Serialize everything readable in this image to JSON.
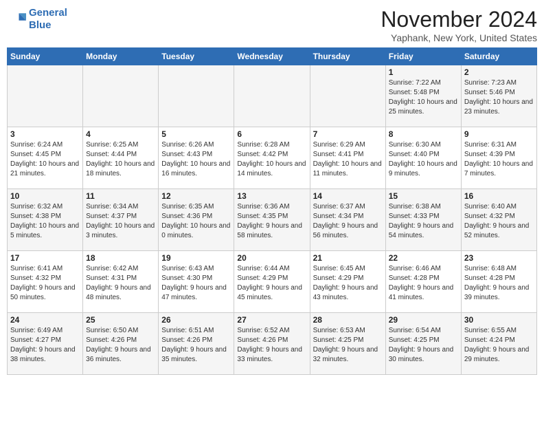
{
  "header": {
    "logo_line1": "General",
    "logo_line2": "Blue",
    "month": "November 2024",
    "location": "Yaphank, New York, United States"
  },
  "days_of_week": [
    "Sunday",
    "Monday",
    "Tuesday",
    "Wednesday",
    "Thursday",
    "Friday",
    "Saturday"
  ],
  "weeks": [
    [
      {
        "day": "",
        "text": ""
      },
      {
        "day": "",
        "text": ""
      },
      {
        "day": "",
        "text": ""
      },
      {
        "day": "",
        "text": ""
      },
      {
        "day": "",
        "text": ""
      },
      {
        "day": "1",
        "text": "Sunrise: 7:22 AM\nSunset: 5:48 PM\nDaylight: 10 hours and 25 minutes."
      },
      {
        "day": "2",
        "text": "Sunrise: 7:23 AM\nSunset: 5:46 PM\nDaylight: 10 hours and 23 minutes."
      }
    ],
    [
      {
        "day": "3",
        "text": "Sunrise: 6:24 AM\nSunset: 4:45 PM\nDaylight: 10 hours and 21 minutes."
      },
      {
        "day": "4",
        "text": "Sunrise: 6:25 AM\nSunset: 4:44 PM\nDaylight: 10 hours and 18 minutes."
      },
      {
        "day": "5",
        "text": "Sunrise: 6:26 AM\nSunset: 4:43 PM\nDaylight: 10 hours and 16 minutes."
      },
      {
        "day": "6",
        "text": "Sunrise: 6:28 AM\nSunset: 4:42 PM\nDaylight: 10 hours and 14 minutes."
      },
      {
        "day": "7",
        "text": "Sunrise: 6:29 AM\nSunset: 4:41 PM\nDaylight: 10 hours and 11 minutes."
      },
      {
        "day": "8",
        "text": "Sunrise: 6:30 AM\nSunset: 4:40 PM\nDaylight: 10 hours and 9 minutes."
      },
      {
        "day": "9",
        "text": "Sunrise: 6:31 AM\nSunset: 4:39 PM\nDaylight: 10 hours and 7 minutes."
      }
    ],
    [
      {
        "day": "10",
        "text": "Sunrise: 6:32 AM\nSunset: 4:38 PM\nDaylight: 10 hours and 5 minutes."
      },
      {
        "day": "11",
        "text": "Sunrise: 6:34 AM\nSunset: 4:37 PM\nDaylight: 10 hours and 3 minutes."
      },
      {
        "day": "12",
        "text": "Sunrise: 6:35 AM\nSunset: 4:36 PM\nDaylight: 10 hours and 0 minutes."
      },
      {
        "day": "13",
        "text": "Sunrise: 6:36 AM\nSunset: 4:35 PM\nDaylight: 9 hours and 58 minutes."
      },
      {
        "day": "14",
        "text": "Sunrise: 6:37 AM\nSunset: 4:34 PM\nDaylight: 9 hours and 56 minutes."
      },
      {
        "day": "15",
        "text": "Sunrise: 6:38 AM\nSunset: 4:33 PM\nDaylight: 9 hours and 54 minutes."
      },
      {
        "day": "16",
        "text": "Sunrise: 6:40 AM\nSunset: 4:32 PM\nDaylight: 9 hours and 52 minutes."
      }
    ],
    [
      {
        "day": "17",
        "text": "Sunrise: 6:41 AM\nSunset: 4:32 PM\nDaylight: 9 hours and 50 minutes."
      },
      {
        "day": "18",
        "text": "Sunrise: 6:42 AM\nSunset: 4:31 PM\nDaylight: 9 hours and 48 minutes."
      },
      {
        "day": "19",
        "text": "Sunrise: 6:43 AM\nSunset: 4:30 PM\nDaylight: 9 hours and 47 minutes."
      },
      {
        "day": "20",
        "text": "Sunrise: 6:44 AM\nSunset: 4:29 PM\nDaylight: 9 hours and 45 minutes."
      },
      {
        "day": "21",
        "text": "Sunrise: 6:45 AM\nSunset: 4:29 PM\nDaylight: 9 hours and 43 minutes."
      },
      {
        "day": "22",
        "text": "Sunrise: 6:46 AM\nSunset: 4:28 PM\nDaylight: 9 hours and 41 minutes."
      },
      {
        "day": "23",
        "text": "Sunrise: 6:48 AM\nSunset: 4:28 PM\nDaylight: 9 hours and 39 minutes."
      }
    ],
    [
      {
        "day": "24",
        "text": "Sunrise: 6:49 AM\nSunset: 4:27 PM\nDaylight: 9 hours and 38 minutes."
      },
      {
        "day": "25",
        "text": "Sunrise: 6:50 AM\nSunset: 4:26 PM\nDaylight: 9 hours and 36 minutes."
      },
      {
        "day": "26",
        "text": "Sunrise: 6:51 AM\nSunset: 4:26 PM\nDaylight: 9 hours and 35 minutes."
      },
      {
        "day": "27",
        "text": "Sunrise: 6:52 AM\nSunset: 4:26 PM\nDaylight: 9 hours and 33 minutes."
      },
      {
        "day": "28",
        "text": "Sunrise: 6:53 AM\nSunset: 4:25 PM\nDaylight: 9 hours and 32 minutes."
      },
      {
        "day": "29",
        "text": "Sunrise: 6:54 AM\nSunset: 4:25 PM\nDaylight: 9 hours and 30 minutes."
      },
      {
        "day": "30",
        "text": "Sunrise: 6:55 AM\nSunset: 4:24 PM\nDaylight: 9 hours and 29 minutes."
      }
    ]
  ]
}
